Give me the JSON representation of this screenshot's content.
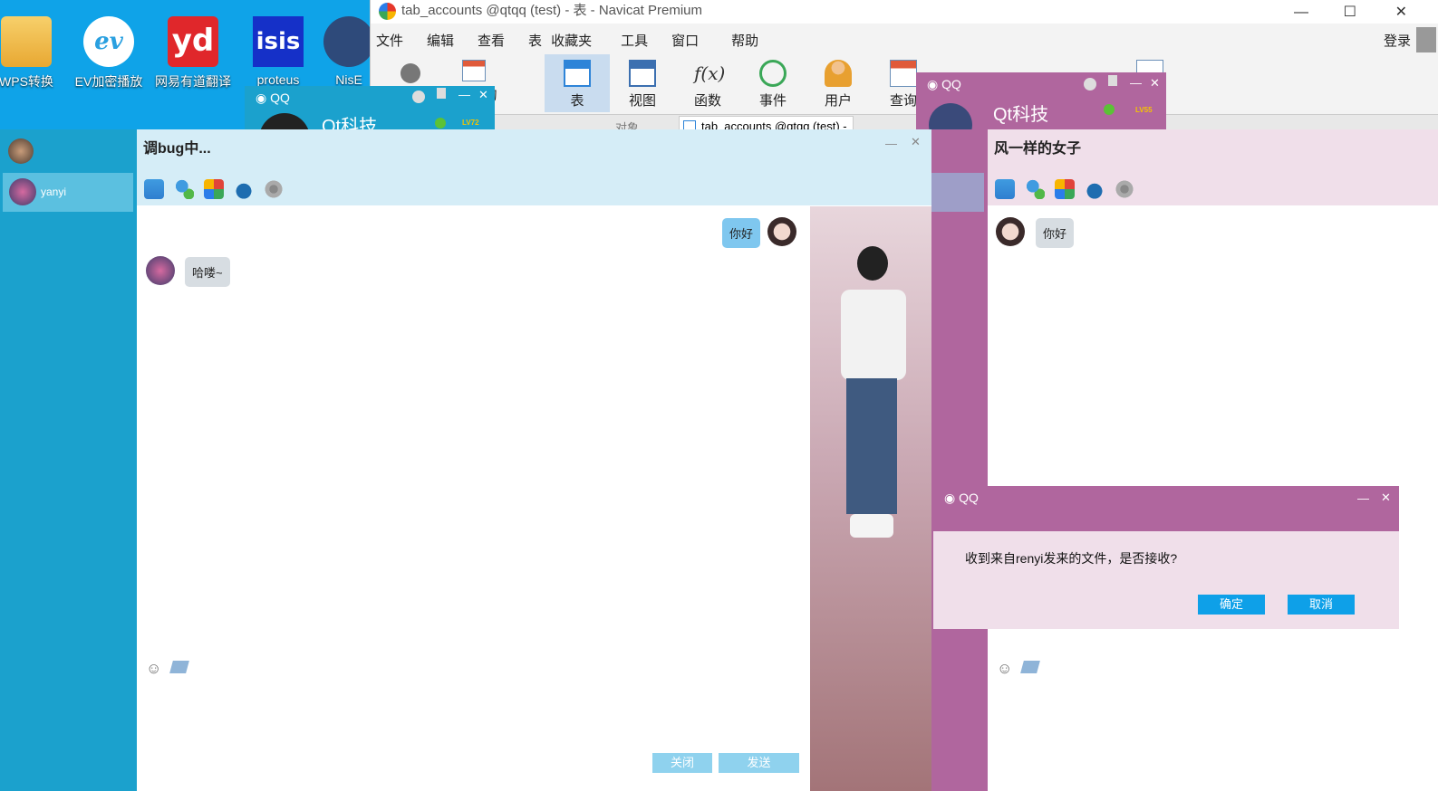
{
  "desktop": {
    "icons": [
      {
        "label": "WPS转换"
      },
      {
        "label": "EV加密播放"
      },
      {
        "label": "网易有道翻译"
      },
      {
        "label": "proteus"
      },
      {
        "label": "NisE"
      }
    ],
    "icon_text": [
      "ev",
      "yd",
      "isis"
    ]
  },
  "navicat": {
    "title": "tab_accounts @qtqq (test) - 表 - Navicat Premium",
    "menu": [
      "文件",
      "编辑",
      "查看",
      "表",
      "收藏夹",
      "工具",
      "窗口",
      "帮助"
    ],
    "login": "登录",
    "tools": [
      "表",
      "视图",
      "函数",
      "事件",
      "用户",
      "查询"
    ],
    "tool_partial": "询",
    "tool_partial2": "型",
    "tab_label": "tab_accounts @qtqq (test) -",
    "tab_object": "对象"
  },
  "qq_mini_left": {
    "app": "QQ",
    "name": "Qt科技",
    "level": "LV72"
  },
  "qq_mini_right": {
    "app": "QQ",
    "name": "Qt科技",
    "level": "LV55"
  },
  "sidebar": {
    "contacts": [
      {
        "name": "yanyi"
      }
    ]
  },
  "chat1": {
    "title": "调bug中...",
    "messages": [
      {
        "side": "right",
        "text": "你好"
      },
      {
        "side": "left",
        "text": "哈喽~"
      }
    ],
    "close_button": "关闭",
    "send_button": "发送"
  },
  "chat2": {
    "title": "风一样的女子",
    "messages": [
      {
        "side": "left",
        "text": "你好"
      }
    ]
  },
  "dialog": {
    "app": "QQ",
    "message": "收到来自renyi发来的文件，是否接收?",
    "ok": "确定",
    "cancel": "取消"
  },
  "colors": {
    "qq_blue": "#1ba1cd",
    "qq_purple": "#b0669e",
    "bubble_blue": "#7fc7ef",
    "bubble_gray": "#d7dde2",
    "button_blue": "#0ea0e8"
  }
}
